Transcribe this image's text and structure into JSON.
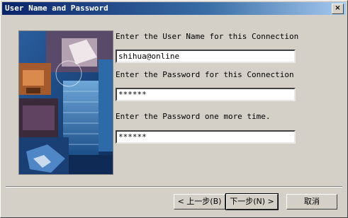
{
  "window": {
    "title": "User Name and Password",
    "close_label": "×"
  },
  "form": {
    "username_label": "Enter the User Name for this Connection",
    "username_value": "shihua@online",
    "password_label": "Enter the Password for this Connection",
    "password_value": "******",
    "confirm_label": "Enter the Password one more time.",
    "confirm_value": "******"
  },
  "buttons": {
    "back": "< 上一步(B)",
    "next": "下一步(N) >",
    "cancel": "取消"
  }
}
